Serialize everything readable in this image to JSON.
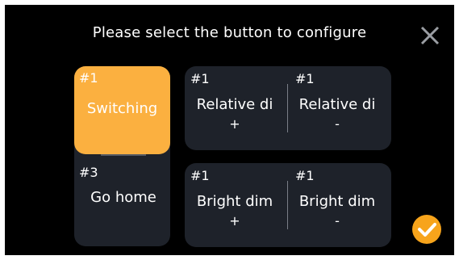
{
  "header": {
    "title": "Please select the button to configure"
  },
  "icons": {
    "close": "close-icon",
    "confirm": "check-icon"
  },
  "colors": {
    "selected": "#fbb040",
    "tile": "#1e222a",
    "confirm": "#f7a41b"
  },
  "buttons": [
    {
      "id": "#1",
      "label": "Switching",
      "selected": true
    },
    {
      "id": "#3",
      "label": "Go home",
      "selected": false
    }
  ],
  "pairs": [
    {
      "left": {
        "id": "#1",
        "label": "Relative di",
        "sign": "+"
      },
      "right": {
        "id": "#1",
        "label": "Relative di",
        "sign": "-"
      }
    },
    {
      "left": {
        "id": "#1",
        "label": "Bright dim",
        "sign": "+"
      },
      "right": {
        "id": "#1",
        "label": "Bright dim",
        "sign": "-"
      }
    }
  ]
}
